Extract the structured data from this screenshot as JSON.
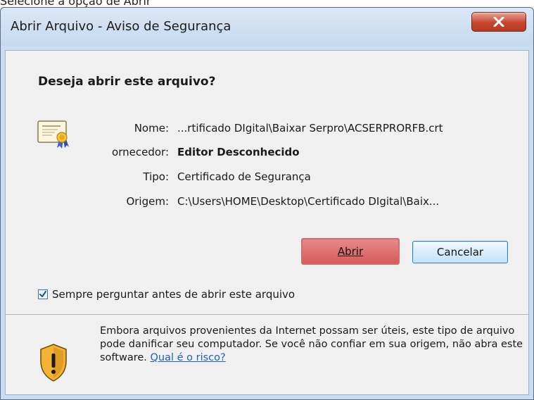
{
  "caption": "Selecione a opção de Abrir",
  "dialog": {
    "title": "Abrir Arquivo - Aviso de Segurança",
    "close_glyph": "X",
    "question": "Deseja abrir este arquivo?",
    "fields": [
      {
        "label": "Nome:",
        "value": "...rtificado DIgital\\Baixar Serpro\\ACSERPRORFB.crt"
      },
      {
        "label": "ornecedor:",
        "value": "Editor Desconhecido"
      },
      {
        "label": "Tipo:",
        "value": "Certificado de Segurança"
      },
      {
        "label": "Origem:",
        "value": "C:\\Users\\HOME\\Desktop\\Certificado DIgital\\Baix..."
      }
    ],
    "buttons": {
      "open": "Abrir",
      "cancel": "Cancelar"
    },
    "checkbox": {
      "label": "Sempre perguntar antes de abrir este arquivo",
      "checked": true
    },
    "warning": {
      "text": "Embora arquivos provenientes da Internet possam ser úteis, este tipo de arquivo pode danificar seu computador. Se você não confiar em sua origem, não abra este software.",
      "link": "Qual é o risco?"
    }
  },
  "colors": {
    "highlight": "#d65a5a",
    "link": "#1f5fbf",
    "close_button": "#c7452e"
  },
  "icons": [
    "certificate-icon",
    "shield-warning-icon",
    "close-icon",
    "checkmark-icon"
  ]
}
